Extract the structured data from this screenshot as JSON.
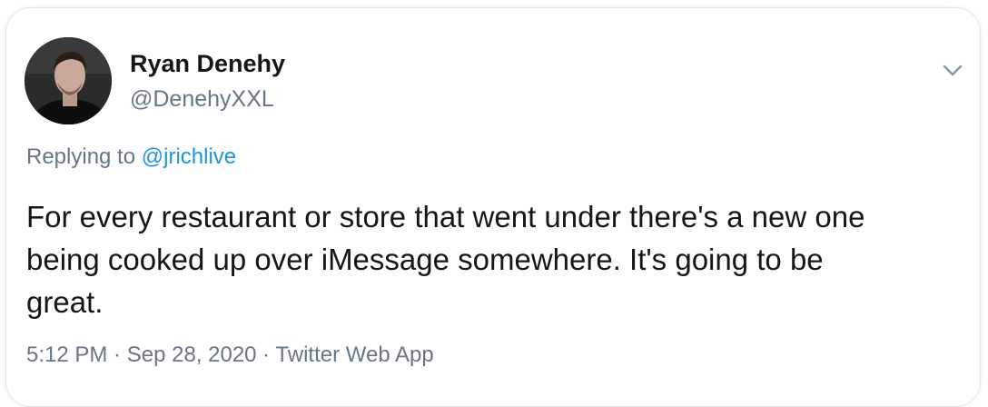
{
  "tweet": {
    "author_name": "Ryan Denehy",
    "author_handle": "@DenehyXXL",
    "replying_to_prefix": "Replying to ",
    "replying_to_handle": "@jrichlive",
    "text": "For every restaurant or store that went under there's a new one\nbeing cooked up over iMessage somewhere. It's going to be\ngreat.",
    "time": "5:12 PM",
    "separator": " · ",
    "date": "Sep 28, 2020",
    "source": "Twitter Web App"
  },
  "icons": {
    "menu": "chevron-down-icon",
    "avatar": "avatar"
  },
  "colors": {
    "link": "#1b95e0",
    "secondary_text": "#657786",
    "primary_text": "#14171a",
    "border": "#e1e8ed"
  }
}
